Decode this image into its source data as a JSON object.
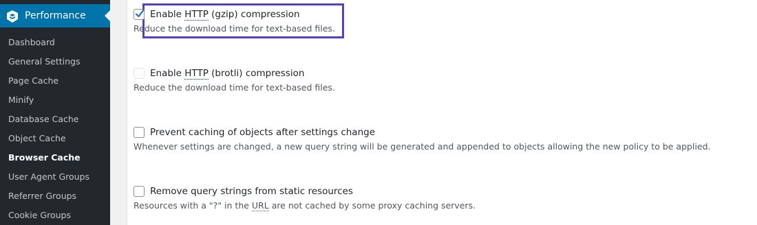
{
  "sidebar": {
    "header_label": "Performance",
    "items": [
      {
        "label": "Dashboard"
      },
      {
        "label": "General Settings"
      },
      {
        "label": "Page Cache"
      },
      {
        "label": "Minify"
      },
      {
        "label": "Database Cache"
      },
      {
        "label": "Object Cache"
      },
      {
        "label": "Browser Cache",
        "current": true
      },
      {
        "label": "User Agent Groups"
      },
      {
        "label": "Referrer Groups"
      },
      {
        "label": "Cookie Groups"
      }
    ]
  },
  "options": [
    {
      "label_pre": "Enable ",
      "label_abbr": "HTTP",
      "label_post": " (gzip) compression",
      "description": "Reduce the download time for text-based files.",
      "checked": true,
      "disabled": false,
      "highlighted": true
    },
    {
      "label_pre": "Enable ",
      "label_abbr": "HTTP",
      "label_post": " (brotli) compression",
      "description": "Reduce the download time for text-based files.",
      "checked": false,
      "disabled": true
    },
    {
      "label": "Prevent caching of objects after settings change",
      "description": "Whenever settings are changed, a new query string will be generated and appended to objects allowing the new policy to be applied.",
      "checked": false,
      "disabled": false
    },
    {
      "label": "Remove query strings from static resources",
      "description_pre": "Resources with a \"?\" in the ",
      "description_abbr": "URL",
      "description_post": " are not cached by some proxy caching servers.",
      "checked": false,
      "disabled": false
    }
  ],
  "colors": {
    "sidebar_bg": "#23282d",
    "menu_head_bg": "#0073aa",
    "highlight_border": "#5b3cc4",
    "check_color": "#2271b1"
  }
}
